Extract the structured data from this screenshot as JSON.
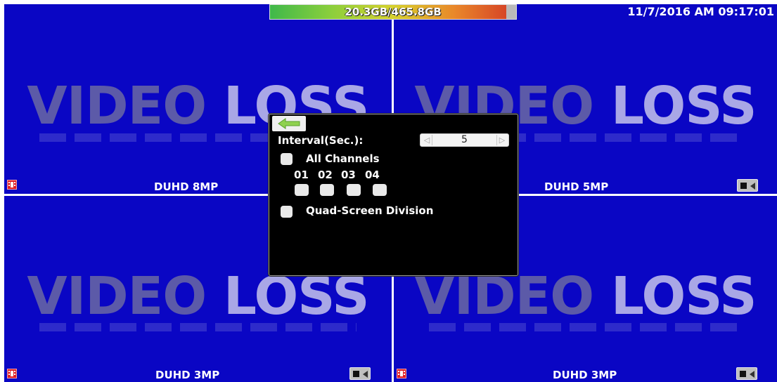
{
  "header": {
    "hdd_usage": "20.3GB/465.8GB",
    "hdd_used_fraction": 0.96,
    "datetime": "11/7/2016 AM 09:17:01"
  },
  "video_loss": {
    "word1": "VIDEO",
    "word2": "LOSS"
  },
  "panes": [
    {
      "label": "DUHD 8MP"
    },
    {
      "label": "DUHD 5MP"
    },
    {
      "label": "DUHD 3MP"
    },
    {
      "label": "DUHD 3MP"
    }
  ],
  "dialog": {
    "interval_label": "Interval(Sec.):",
    "interval_value": "5",
    "all_channels_label": "All Channels",
    "channels": [
      "01",
      "02",
      "03",
      "04"
    ],
    "quad_label": "Quad-Screen Division"
  },
  "colors": {
    "pane_bg": "#0a06c4",
    "divider": "#ffffff",
    "dialog_bg": "#000000"
  },
  "icons": [
    "film-icon",
    "record-icon",
    "speaker-icon",
    "back-arrow-icon",
    "spin-left-arrow-icon",
    "spin-right-arrow-icon"
  ]
}
